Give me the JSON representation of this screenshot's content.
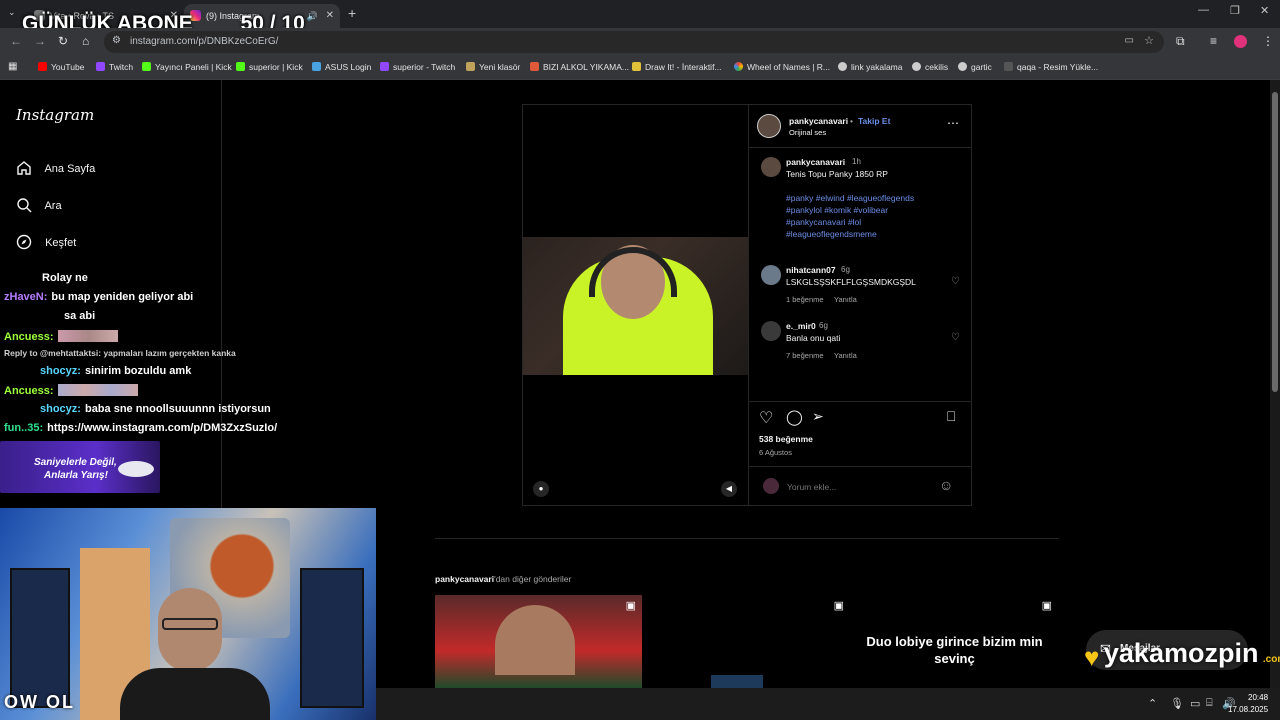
{
  "browser": {
    "tabs": [
      {
        "label": "Vita • Rova • TS",
        "active": false
      },
      {
        "label": "(9) Instagram",
        "active": true
      }
    ],
    "url": "instagram.com/p/DNBKzeCoErG/",
    "bookmarks": [
      "YouTube",
      "Twitch",
      "Yayıncı Paneli | Kick",
      "superior | Kick",
      "ASUS Login",
      "superior - Twitch",
      "Yeni klasör",
      "BIZI ALKOL YIKAMA...",
      "Draw It! - İnteraktif...",
      "Wheel of Names | R...",
      "link yakalama",
      "cekilis",
      "gartic",
      "qaqa - Resim Yükle..."
    ]
  },
  "overlay": {
    "title": "GÜNLÜK ABONE",
    "counter": "50 / 10",
    "cam_caption": "OW OL",
    "promo_line1": "Saniyelerle Değil,",
    "promo_line2": "Anlarla Yarış!",
    "brand": "yakamozpin",
    "brand_suffix": ".com",
    "chat": [
      {
        "user": "",
        "text": "Rolay ne",
        "color": "#ff5a5a"
      },
      {
        "user": "zHaveN:",
        "text": "bu map yeniden geliyor abi",
        "color": "#b57cff"
      },
      {
        "user": "",
        "text": "sa abi",
        "color": "#ff5a5a"
      },
      {
        "user": "Ancuess:",
        "text": "",
        "color": "#9cff3c"
      },
      {
        "user": "",
        "text": "Reply to @mehtattaktsi: yapmaları lazım gerçekten kanka",
        "color": "#d0d0d0"
      },
      {
        "user": "shocyz:",
        "text": "sinirim bozuldu amk",
        "color": "#5ad7ff"
      },
      {
        "user": "Ancuess:",
        "text": "",
        "color": "#9cff3c"
      },
      {
        "user": "shocyz:",
        "text": "baba sne nnoollsuuunnn istiyorsun",
        "color": "#5ad7ff"
      },
      {
        "user": "fun..35:",
        "text": "https://www.instagram.com/p/DM3ZxzSuzIo/",
        "color": "#2fe08a"
      }
    ]
  },
  "instagram": {
    "logo": "Instagram",
    "nav": [
      {
        "label": "Ana Sayfa",
        "icon": "home-icon"
      },
      {
        "label": "Ara",
        "icon": "search-icon"
      },
      {
        "label": "Keşfet",
        "icon": "compass-icon"
      }
    ],
    "post": {
      "username": "pankycanavari",
      "follow": "Takip Et",
      "audio": "Orijinal ses",
      "caption_user": "pankycanavari",
      "caption_time": "1h",
      "caption": "Tenis Topu Panky 1850 RP",
      "hashtags": [
        "#panky #elwind #leagueoflegends",
        "#pankylol #komik #volibear",
        "#pankycanavari #lol",
        "#leagueoflegendsmeme"
      ],
      "comments": [
        {
          "user": "nihatcann07",
          "time": "6g",
          "text": "LSKGLSŞSKFLFLGŞSMDKGŞDL",
          "likes": "1 beğenme",
          "reply": "Yanıtla"
        },
        {
          "user": "e._mir0",
          "time": "6g",
          "text": "Banla onu qati",
          "likes": "7 beğenme",
          "reply": "Yanıtla"
        }
      ],
      "like_count": "538 beğenme",
      "date": "6 Ağustos",
      "comment_placeholder": "Yorum ekle..."
    },
    "more_posts_user": "pankycanavari",
    "more_posts_suffix": "'dan diğer gönderiler",
    "grid_caption": "Duo lobiye girince bizim min sevinç",
    "messages_label": "Mesajlar"
  },
  "taskbar": {
    "time": "20:48",
    "date": "17.08.2025"
  },
  "colors": {
    "instagram_blue": "#6d8ee8",
    "chrome_bg": "#35363a",
    "brand_yellow": "#f5c518"
  }
}
